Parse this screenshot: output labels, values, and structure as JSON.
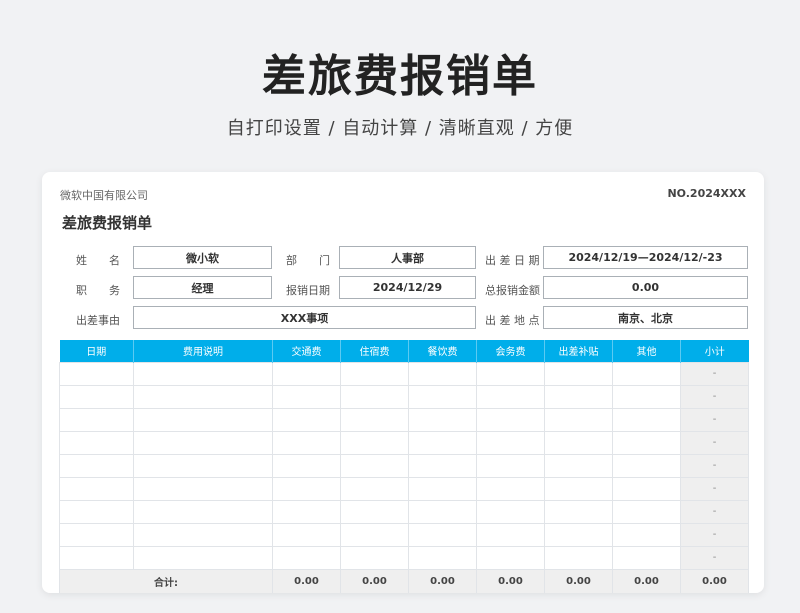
{
  "hero": {
    "title": "差旅费报销单",
    "subtitle": "自打印设置 / 自动计算 / 清晰直观 / 方便"
  },
  "form": {
    "company": "微软中国有限公司",
    "doc_no": "NO.2024XXX",
    "title": "差旅费报销单",
    "fields": {
      "name": {
        "label": "姓　　名",
        "value": "微小软"
      },
      "department": {
        "label": "部　　门",
        "value": "人事部"
      },
      "trip_dates": {
        "label": "出 差 日 期",
        "value": "2024/12/19—2024/12/-23"
      },
      "position": {
        "label": "职　　务",
        "value": "经理"
      },
      "report_date": {
        "label": "报销日期",
        "value": "2024/12/29"
      },
      "total_amount": {
        "label": "总报销金额",
        "value": "0.00"
      },
      "reason": {
        "label": "出差事由",
        "value": "XXX事项"
      },
      "location": {
        "label": "出 差 地 点",
        "value": "南京、北京"
      }
    }
  },
  "table": {
    "headers": [
      "日期",
      "费用说明",
      "交通费",
      "住宿费",
      "餐饮费",
      "会务费",
      "出差补贴",
      "其他",
      "小计"
    ],
    "rows": [
      {
        "subtotal": "-"
      },
      {
        "subtotal": "-"
      },
      {
        "subtotal": "-"
      },
      {
        "subtotal": "-"
      },
      {
        "subtotal": "-"
      },
      {
        "subtotal": "-"
      },
      {
        "subtotal": "-"
      },
      {
        "subtotal": "-"
      },
      {
        "subtotal": "-"
      }
    ],
    "total": {
      "label": "合计:",
      "values": [
        "0.00",
        "0.00",
        "0.00",
        "0.00",
        "0.00",
        "0.00",
        "0.00"
      ]
    }
  },
  "colors": {
    "header_bg": "#00aeea",
    "subtotal_bg": "#efefef"
  }
}
